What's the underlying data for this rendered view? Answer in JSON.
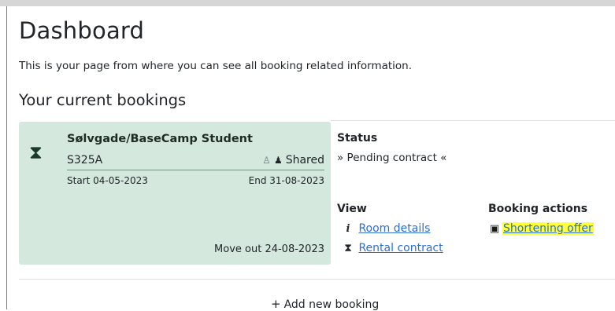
{
  "header": {
    "title": "Dashboard",
    "subtitle": "This is your page from where you can see all booking related information."
  },
  "bookings_section": {
    "title": "Your current bookings"
  },
  "booking": {
    "property": "Sølvgade/BaseCamp Student",
    "room": "S325A",
    "room_type": "Shared",
    "start": "Start 04-05-2023",
    "end": "End 31-08-2023",
    "move_out": "Move out 24-08-2023",
    "status_label": "Status",
    "status_value": "» Pending contract «",
    "view_label": "View",
    "links": {
      "room_details": "Room details",
      "rental_contract": "Rental contract"
    },
    "actions_label": "Booking actions",
    "actions": {
      "shortening_offer": "Shortening offer"
    }
  },
  "add_booking": {
    "label": "Add new booking"
  },
  "icons": {
    "card": "hourglass-icon",
    "room_details": "info-icon",
    "rental_contract": "hourglass-icon",
    "shortening_offer": "calendar-icon",
    "shared": "person-icon",
    "add": "plus-icon"
  },
  "colors": {
    "card_background": "#d4e8de",
    "link": "#2c6fd0",
    "highlight": "#ffff3a"
  }
}
